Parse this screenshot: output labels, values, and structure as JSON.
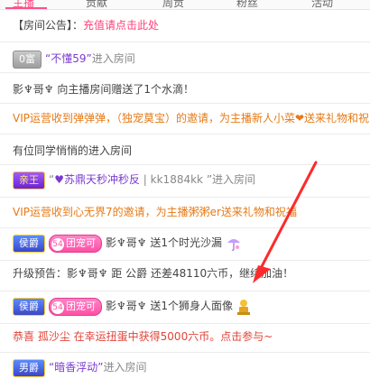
{
  "tabs": [
    "主播",
    "贡献",
    "周贡",
    "粉丝",
    "活动"
  ],
  "announcement": {
    "label": "【房间公告】",
    "sep": "：",
    "text": "充值请点击此处"
  },
  "messages": {
    "m1": {
      "badge": "0富",
      "user": "“不懂59”",
      "action": "进入房间"
    },
    "m2": {
      "user": "影♆哥♆",
      "action": "向主播房间赠送了1个水滴！"
    },
    "m3": {
      "text": "VIP运营收到弹弹弹，（独宠莫宝）的邀请，为主播新人小菜❤送来礼物和祝"
    },
    "m4": {
      "text": "有位同学悄悄的进入房间"
    },
    "m5": {
      "badge": "亲王",
      "prefix": "“",
      "user": "♥苏鼎天秒冲秒反",
      "sep": " | ",
      "user_id": "kk1884kk",
      "suffix": " ”",
      "action": "进入房间"
    },
    "m6": {
      "text": "VIP运营收到心无界7的邀请，为主播粥粥er送来礼物和祝福"
    },
    "m7": {
      "badge": "侯爵",
      "level": "54",
      "fan_badge": "团宠可",
      "user": "影♆哥♆",
      "action": "送1个时光沙漏"
    },
    "m8": {
      "text": "升级预告：影♆哥♆ 距 公爵 还差48110六币，继续加油！"
    },
    "m9": {
      "badge": "侯爵",
      "level": "54",
      "fan_badge": "团宠可",
      "user": "影♆哥♆",
      "action": "送1个狮身人面像"
    },
    "m10": {
      "prefix": "恭喜 ",
      "user": "孤沙尘",
      "text": " 在幸运扭蛋中获得5000六币。点击参与~"
    },
    "m11": {
      "badge": "男爵",
      "user": "“暗香浮动”",
      "action": "进入房间"
    }
  },
  "colors": {
    "accent": "#ff4f86",
    "announcement_text": "#ff3f7a",
    "vip_text": "#e57a17",
    "lucky_text": "#e0443a",
    "arrow": "#ff2a2a"
  }
}
